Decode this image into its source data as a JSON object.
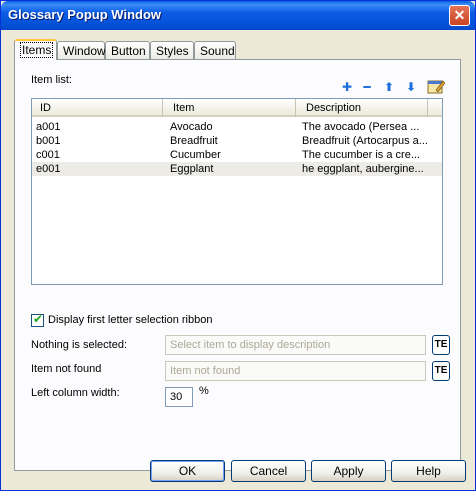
{
  "window": {
    "title": "Glossary Popup Window",
    "close_glyph": "✕"
  },
  "tabs": [
    {
      "label": "Items",
      "active": true
    },
    {
      "label": "Window"
    },
    {
      "label": "Button"
    },
    {
      "label": "Styles"
    },
    {
      "label": "Sound"
    }
  ],
  "items": {
    "list_label": "Item list:",
    "toolbar_icons": [
      "add-icon",
      "remove-icon",
      "move-up-icon",
      "move-down-icon",
      "edit-icon"
    ],
    "columns": [
      "ID",
      "Item",
      "Description"
    ],
    "rows": [
      {
        "id": "a001",
        "item": "Avocado",
        "description": "The avocado (Persea ..."
      },
      {
        "id": "b001",
        "item": "Breadfruit",
        "description": "Breadfruit (Artocarpus a..."
      },
      {
        "id": "c001",
        "item": "Cucumber",
        "description": "The cucumber is a cre..."
      },
      {
        "id": "e001",
        "item": "Eggplant",
        "description": "he eggplant, aubergine..."
      }
    ],
    "selected_row": 3
  },
  "options": {
    "ribbon_checkbox_label": "Display first letter selection ribbon",
    "ribbon_checked": true,
    "nothing_selected_label": "Nothing is selected:",
    "nothing_selected_placeholder": "Select item to display description",
    "not_found_label": "Item not found",
    "not_found_placeholder": "Item not found",
    "te_label": "TE",
    "left_col_label": "Left column width:",
    "left_col_value": "30",
    "left_col_unit": "%"
  },
  "buttons": {
    "ok": "OK",
    "cancel": "Cancel",
    "apply": "Apply",
    "help": "Help"
  }
}
